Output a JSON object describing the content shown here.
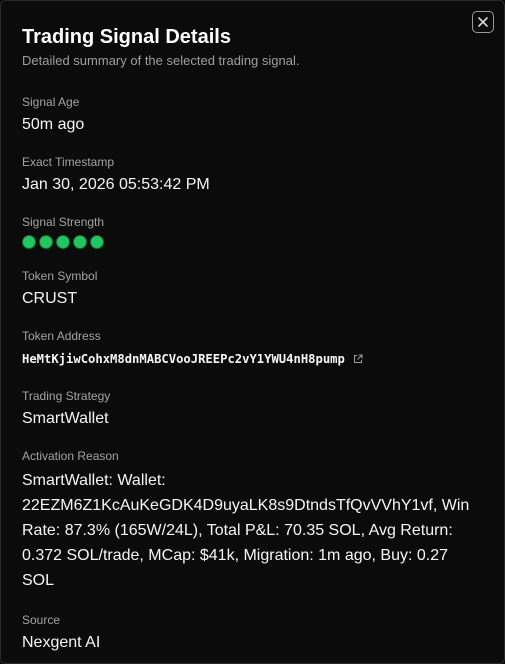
{
  "dialog": {
    "title": "Trading Signal Details",
    "subtitle": "Detailed summary of the selected trading signal.",
    "close_icon": "close-icon"
  },
  "fields": {
    "signal_age": {
      "label": "Signal Age",
      "value": "50m ago"
    },
    "timestamp": {
      "label": "Exact Timestamp",
      "value": "Jan 30, 2026 05:53:42 PM"
    },
    "strength": {
      "label": "Signal Strength",
      "level": 5,
      "max": 5,
      "dot_color": "#22c55e"
    },
    "token_symbol": {
      "label": "Token Symbol",
      "value": "CRUST"
    },
    "token_address": {
      "label": "Token Address",
      "value": "HeMtKjiwCohxM8dnMABCVooJREEPc2vY1YWU4nH8pump",
      "link_icon": "external-link-icon"
    },
    "strategy": {
      "label": "Trading Strategy",
      "value": "SmartWallet"
    },
    "activation_reason": {
      "label": "Activation Reason",
      "value": "SmartWallet: Wallet: 22EZM6Z1KcAuKeGDK4D9uyaLK8s9DtndsTfQvVVhY1vf, Win Rate: 87.3% (165W/24L), Total P&L: 70.35 SOL, Avg Return: 0.372 SOL/trade, MCap: $41k, Migration: 1m ago, Buy: 0.27 SOL"
    },
    "source": {
      "label": "Source",
      "value": "Nexgent AI"
    }
  }
}
